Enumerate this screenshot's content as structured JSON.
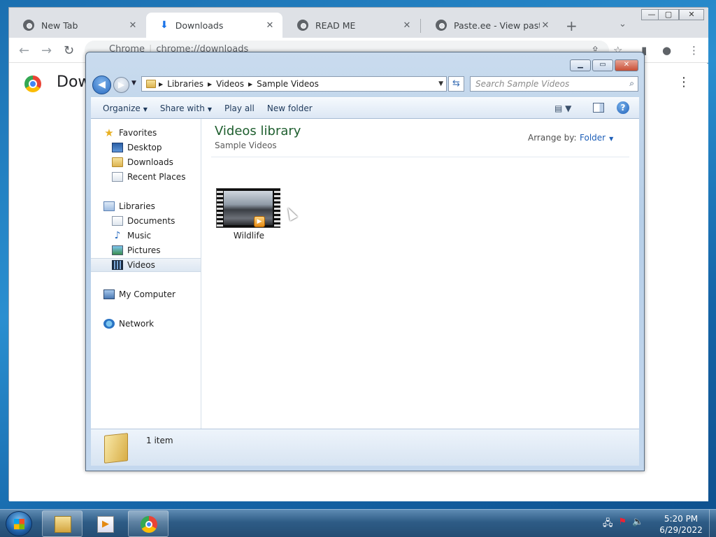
{
  "chrome": {
    "tabs": [
      {
        "title": "New Tab"
      },
      {
        "title": "Downloads"
      },
      {
        "title": "READ ME"
      },
      {
        "title": "Paste.ee - View paste H"
      }
    ],
    "tab_close_glyph": "✕",
    "new_tab_glyph": "+",
    "omnibox": {
      "site_label": "Chrome",
      "url": "chrome://downloads"
    },
    "page": {
      "title": "Dow"
    }
  },
  "explorer": {
    "breadcrumbs": [
      "Libraries",
      "Videos",
      "Sample Videos"
    ],
    "search_placeholder": "Search Sample Videos",
    "commands": [
      {
        "label": "Organize",
        "dropdown": true
      },
      {
        "label": "Share with",
        "dropdown": true
      },
      {
        "label": "Play all",
        "dropdown": false
      },
      {
        "label": "New folder",
        "dropdown": false
      }
    ],
    "nav": {
      "favorites": {
        "label": "Favorites",
        "items": [
          "Desktop",
          "Downloads",
          "Recent Places"
        ]
      },
      "libraries": {
        "label": "Libraries",
        "items": [
          "Documents",
          "Music",
          "Pictures",
          "Videos"
        ],
        "selected": "Videos"
      },
      "computer": "My Computer",
      "network": "Network"
    },
    "content": {
      "title": "Videos library",
      "subtitle": "Sample Videos",
      "arrange_label": "Arrange by:",
      "arrange_value": "Folder",
      "items": [
        {
          "name": "Wildlife",
          "type": "video"
        }
      ]
    },
    "status": {
      "text": "1 item"
    }
  },
  "taskbar": {
    "pinned": [
      "windows-explorer",
      "windows-media-player",
      "google-chrome"
    ],
    "clock": {
      "time": "5:20 PM",
      "date": "6/29/2022"
    }
  },
  "colors": {
    "library_title": "#1e5e2e",
    "link_blue": "#1e5fb8",
    "taskbar": "#2e5c86"
  }
}
